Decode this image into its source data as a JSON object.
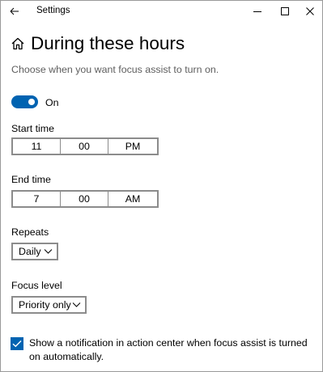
{
  "window": {
    "title": "Settings"
  },
  "page": {
    "title": "During these hours",
    "subtitle": "Choose when you want focus assist to turn on."
  },
  "toggle": {
    "state_label": "On",
    "on": true
  },
  "start_time": {
    "label": "Start time",
    "hour": "11",
    "minute": "00",
    "period": "PM"
  },
  "end_time": {
    "label": "End time",
    "hour": "7",
    "minute": "00",
    "period": "AM"
  },
  "repeats": {
    "label": "Repeats",
    "selected": "Daily"
  },
  "focus_level": {
    "label": "Focus level",
    "selected": "Priority only"
  },
  "notification": {
    "checked": true,
    "text": "Show a notification in action center when focus assist is turned on automatically."
  },
  "colors": {
    "accent": "#0063b1",
    "subtitle_text": "#5e5e5e",
    "control_border": "#8c8c8c"
  },
  "icons": [
    "back-arrow-icon",
    "minimize-icon",
    "maximize-icon",
    "close-icon",
    "home-icon",
    "chevron-down-icon",
    "checkmark-icon"
  ]
}
